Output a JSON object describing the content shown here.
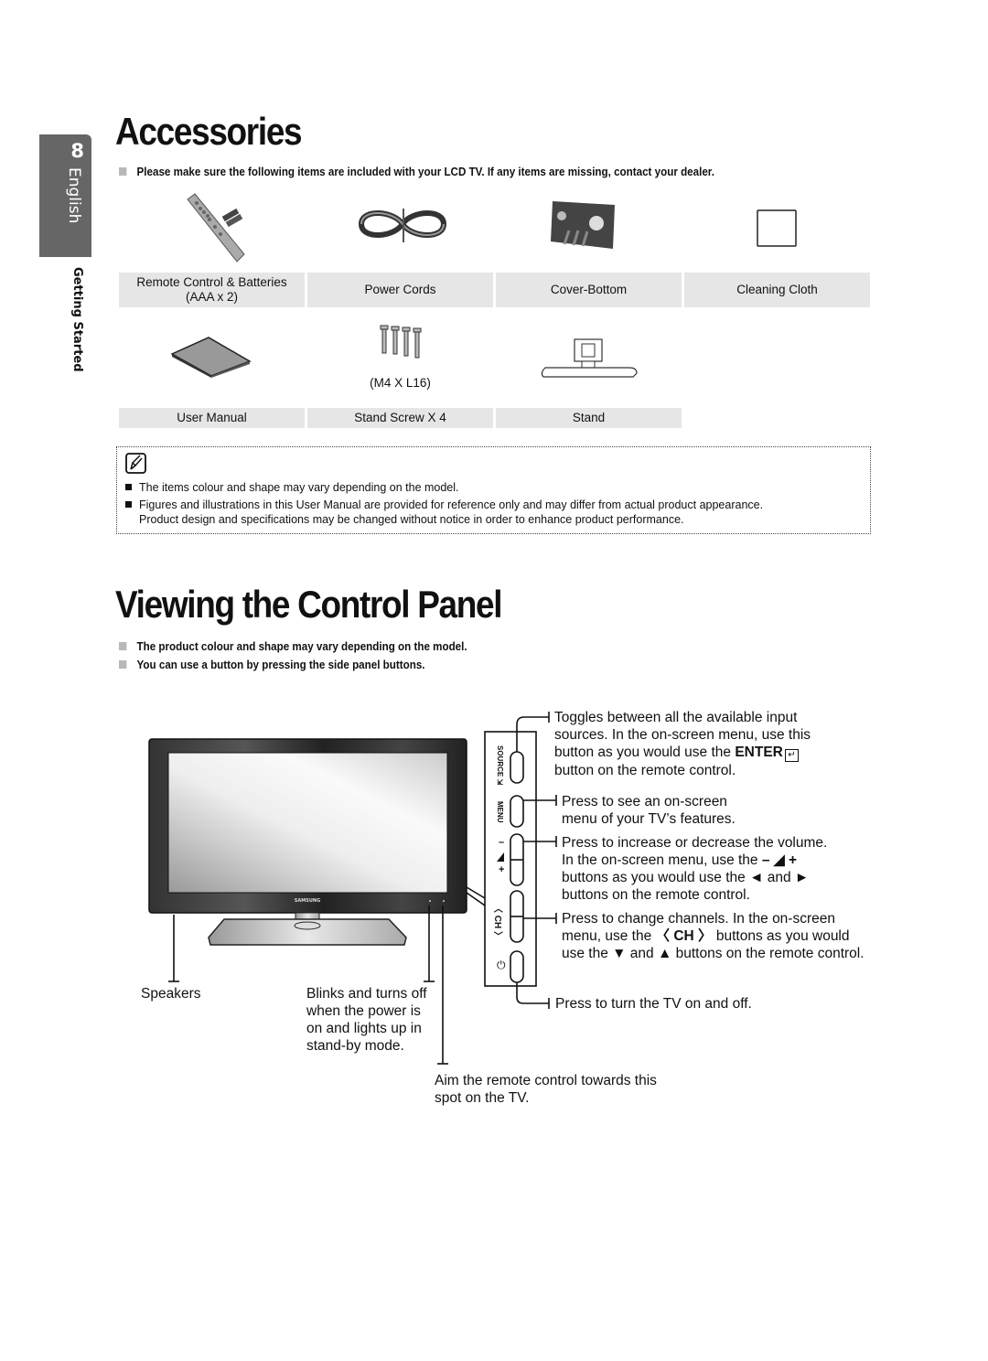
{
  "side_tab": {
    "page_number": "8",
    "language": "English",
    "section": "Getting Started"
  },
  "accessories": {
    "title": "Accessories",
    "intro": "Please make sure the following items are included with your LCD TV. If any items are missing, contact your dealer.",
    "items": [
      {
        "icon": "remote-control",
        "label_line1": "Remote Control & Batteries",
        "label_line2": "(AAA x 2)"
      },
      {
        "icon": "power-cord",
        "label": "Power Cords"
      },
      {
        "icon": "cover-bottom",
        "label": "Cover-Bottom"
      },
      {
        "icon": "cleaning-cloth",
        "label": "Cleaning Cloth"
      },
      {
        "icon": "user-manual",
        "label": "User Manual"
      },
      {
        "icon": "screws",
        "caption": "(M4 X L16)",
        "label": "Stand Screw X 4"
      },
      {
        "icon": "stand",
        "label": "Stand"
      }
    ]
  },
  "note": {
    "icon": "note-pencil",
    "lines": [
      "The items colour and shape may vary depending on the model.",
      "Figures and illustrations in this User Manual are provided for reference only and may differ from actual product appearance.",
      "Product design and specifications may be changed without notice in order to enhance product performance."
    ]
  },
  "control_panel": {
    "title": "Viewing the Control Panel",
    "bullets": [
      "The product colour and shape may vary depending on the model.",
      "You can use a button by pressing the side panel buttons."
    ],
    "tv_brand": "SAMSUNG",
    "panel_labels": {
      "source": "SOURCE",
      "menu": "MENU",
      "vol_minus": "–",
      "vol_plus": "+",
      "ch": "CH"
    },
    "callouts": {
      "source": [
        "Toggles between all the available input",
        "sources. In the on-screen menu, use this",
        "button as you would use the ",
        "button on the remote control."
      ],
      "source_enter": "ENTER",
      "menu": [
        "Press to see an on-screen",
        "menu of your TV’s features."
      ],
      "volume": [
        "Press to increase or decrease the volume.",
        "In the on-screen menu, use the",
        "buttons as you would use the ◄ and ►",
        "buttons on the remote control."
      ],
      "volume_symbols": "– ◢ +",
      "channel": [
        "Press to change channels. In the on-screen",
        "menu, use the",
        "buttons as you would",
        "use the ▼ and ▲ buttons on the remote control."
      ],
      "channel_symbol": "〈 CH 〉",
      "power": "Press to turn the TV on and off.",
      "speakers": "Speakers",
      "power_led": [
        "Blinks and turns off",
        "when the power is",
        "on and lights up in",
        "stand-by mode."
      ],
      "remote_sensor": [
        "Aim the remote control towards this",
        "spot on the TV."
      ]
    }
  }
}
